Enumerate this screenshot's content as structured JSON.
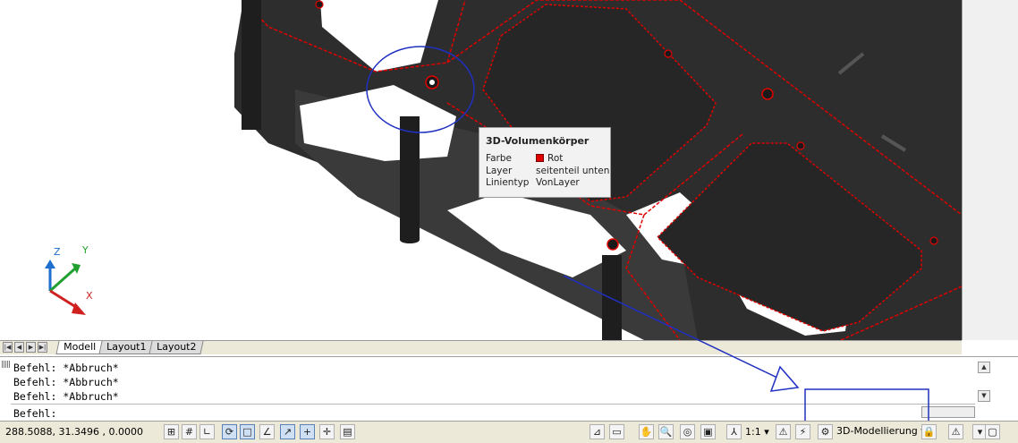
{
  "tooltip": {
    "title": "3D-Volumenkörper",
    "rows": [
      {
        "key": "Farbe",
        "value": "Rot"
      },
      {
        "key": "Layer",
        "value": "seitenteil unten"
      },
      {
        "key": "Linientyp",
        "value": "VonLayer"
      }
    ],
    "color_swatch": "#e00000"
  },
  "ucs": {
    "z": "Z",
    "y": "Y",
    "x": "X"
  },
  "layout_tabs": [
    "Modell",
    "Layout1",
    "Layout2"
  ],
  "command": {
    "history": [
      "Befehl: *Abbruch*",
      "Befehl: *Abbruch*",
      "Befehl: *Abbruch*"
    ],
    "prompt": "Befehl:"
  },
  "status": {
    "coordinates": "288.5088, 31.3496 , 0.0000",
    "annotation_scale": "1:1",
    "workspace": "3D-Modellierung"
  },
  "colors": {
    "model_body": "#2e2e2e",
    "highlight_edge": "#e00000",
    "annotation": "#2030c0"
  }
}
